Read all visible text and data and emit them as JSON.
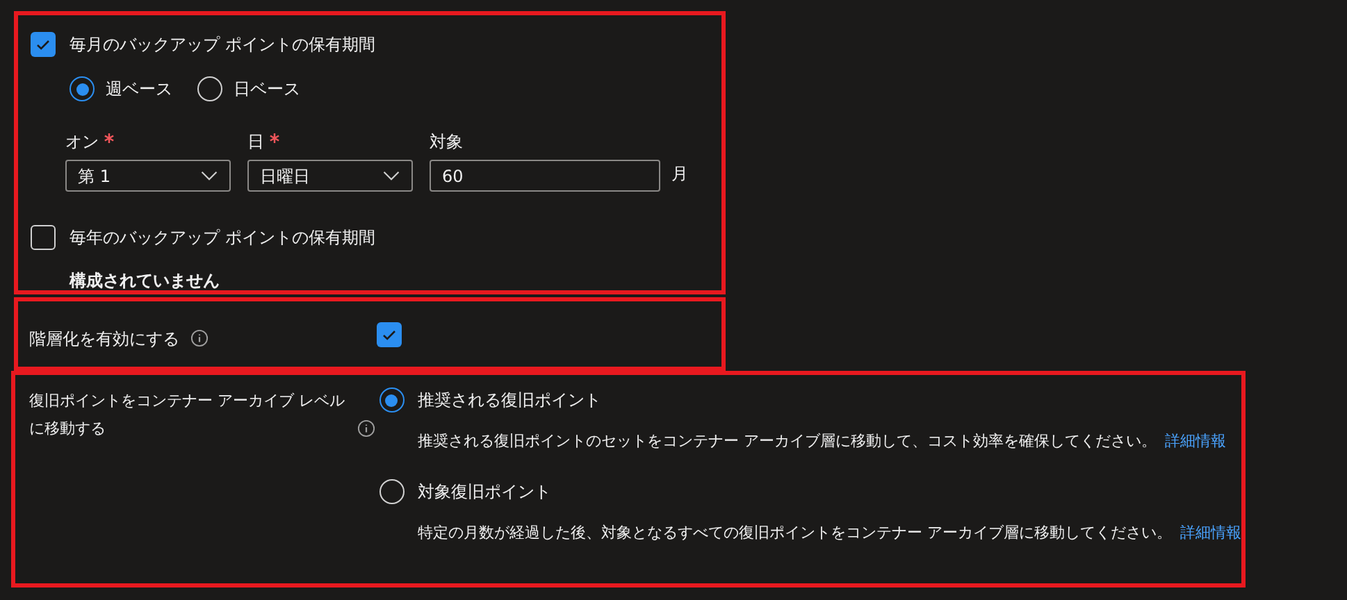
{
  "monthly": {
    "label": "毎月のバックアップ ポイントの保有期間",
    "checked": true,
    "basis": [
      {
        "label": "週ベース",
        "selected": true
      },
      {
        "label": "日ベース",
        "selected": false
      }
    ],
    "fields": [
      {
        "kind": "dropdown",
        "label": "オン",
        "required": true,
        "value": "第 1"
      },
      {
        "kind": "dropdown",
        "label": "日",
        "required": true,
        "value": "日曜日"
      },
      {
        "kind": "input",
        "label": "対象",
        "required": false,
        "value": "60",
        "unit": "月"
      }
    ]
  },
  "yearly": {
    "label": "毎年のバックアップ ポイントの保有期間",
    "checked": false,
    "status": "構成されていません"
  },
  "tiering": {
    "label": "階層化を有効にする",
    "checked": true
  },
  "archive": {
    "label": "復旧ポイントをコンテナー アーカイブ レベルに移動する",
    "options": [
      {
        "label": "推奨される復旧ポイント",
        "selected": true,
        "description": "推奨される復旧ポイントのセットをコンテナー アーカイブ層に移動して、コスト効率を確保してください。",
        "link": "詳細情報"
      },
      {
        "label": "対象復旧ポイント",
        "selected": false,
        "description": "特定の月数が経過した後、対象となるすべての復旧ポイントをコンテナー アーカイブ層に移動してください。",
        "link": "詳細情報"
      }
    ]
  }
}
